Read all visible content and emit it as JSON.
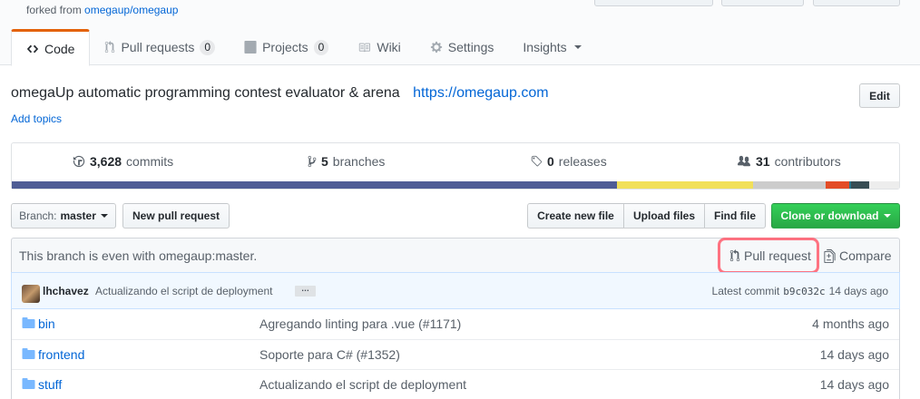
{
  "header": {
    "forked_prefix": "forked from",
    "forked_repo": "omegaup/omegaup"
  },
  "tabs": [
    {
      "label": "Code",
      "icon": "code-icon",
      "selected": true
    },
    {
      "label": "Pull requests",
      "icon": "git-pull-request-icon",
      "count": "0"
    },
    {
      "label": "Projects",
      "icon": "project-icon",
      "count": "0"
    },
    {
      "label": "Wiki",
      "icon": "book-icon"
    },
    {
      "label": "Settings",
      "icon": "gear-icon"
    },
    {
      "label": "Insights",
      "icon": "chevron-down-icon"
    }
  ],
  "repo": {
    "description": "omegaUp automatic programming contest evaluator & arena",
    "url": "https://omegaup.com",
    "edit_label": "Edit",
    "add_topics": "Add topics"
  },
  "summary": {
    "commits_count": "3,628",
    "commits_label": "commits",
    "branches_count": "5",
    "branches_label": "branches",
    "releases_count": "0",
    "releases_label": "releases",
    "contributors_count": "31",
    "contributors_label": "contributors"
  },
  "language_bar": [
    {
      "color": "#4F5D95",
      "share": 0.682
    },
    {
      "color": "#f1e05a",
      "share": 0.153
    },
    {
      "color": "#cccccc",
      "share": 0.082
    },
    {
      "color": "#e34c26",
      "share": 0.027
    },
    {
      "color": "#2b7489",
      "share": 0.002
    },
    {
      "color": "#384d54",
      "share": 0.02
    },
    {
      "color": "#ededed",
      "share": 0.034
    }
  ],
  "toolbar": {
    "branch_prefix": "Branch:",
    "branch_name": "master",
    "new_pull_request": "New pull request",
    "create_new_file": "Create new file",
    "upload_files": "Upload files",
    "find_file": "Find file",
    "clone_or_download": "Clone or download"
  },
  "branch_info": {
    "status": "This branch is even with omegaup:master.",
    "pull_request": "Pull request",
    "compare": "Compare"
  },
  "latest_commit": {
    "author": "lhchavez",
    "message": "Actualizando el script de deployment",
    "ellipsis": "…",
    "prefix": "Latest commit",
    "sha": "b9c032c",
    "age": "14 days ago"
  },
  "files": [
    {
      "name": "bin",
      "message": "Agregando linting para .vue (#1171)",
      "age": "4 months ago"
    },
    {
      "name": "frontend",
      "message": "Soporte para C# (#1352)",
      "age": "14 days ago"
    },
    {
      "name": "stuff",
      "message": "Actualizando el script de deployment",
      "age": "14 days ago"
    }
  ],
  "colors": {
    "accent": "#0366d6",
    "tab_underline": "#e36209",
    "clone_button": "#28a745",
    "annotation_highlight": "#ff5b6b"
  }
}
